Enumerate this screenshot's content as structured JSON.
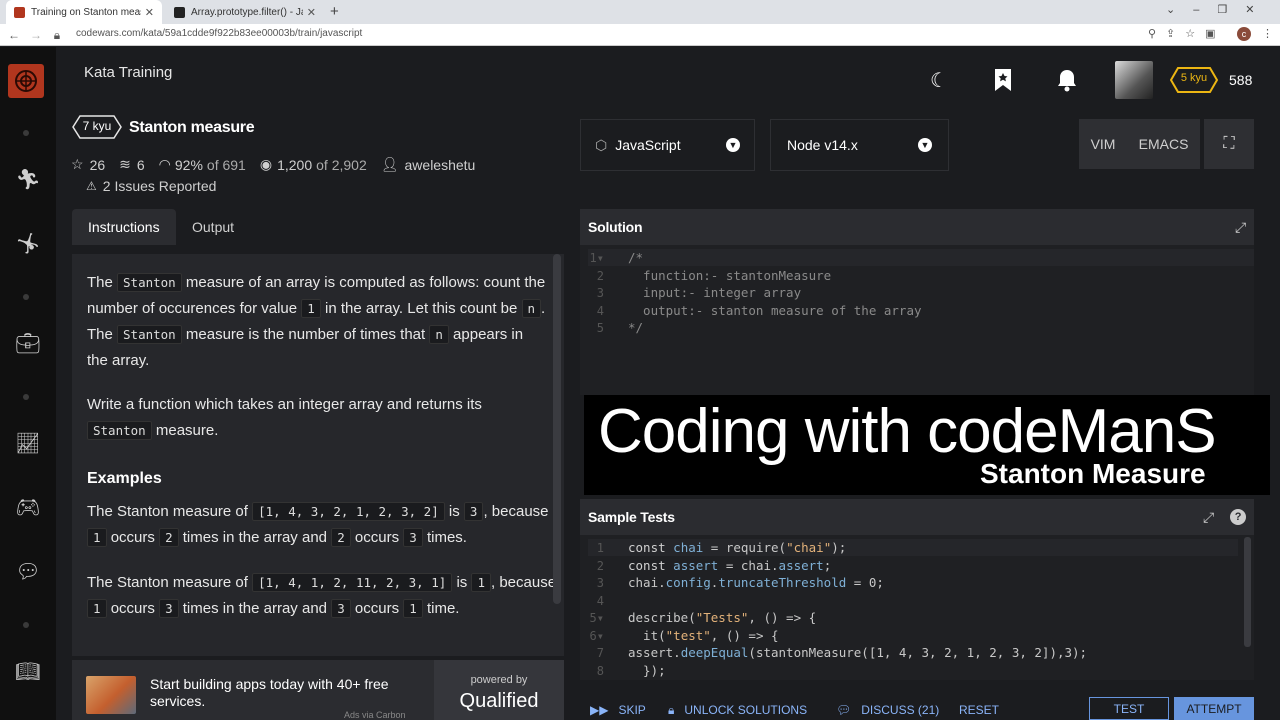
{
  "browser": {
    "tabs": [
      {
        "title": "Training on Stanton measure | C..."
      },
      {
        "title": "Array.prototype.filter() - JavaScri..."
      }
    ],
    "url": "codewars.com/kata/59a1cdde9f922b83ee00003b/train/javascript"
  },
  "header": {
    "section_title": "Kata Training",
    "rank_badge": "5 kyu",
    "honor": "588"
  },
  "kata": {
    "rank": "7 kyu",
    "title": "Stanton measure",
    "stars": "26",
    "collections": "6",
    "satisfaction": "92%",
    "satisfaction_of": "of 691",
    "completed": "1,200",
    "completed_of": "of 2,902",
    "author": "aweleshetu",
    "issues": "2 Issues Reported"
  },
  "tabs": {
    "instructions": "Instructions",
    "output": "Output"
  },
  "instructions": {
    "p1_a": "The",
    "p1_code1": "Stanton",
    "p1_b": "measure of an array is computed as follows: count the number of occurences for value",
    "p1_code2": "1",
    "p1_c": "in the array. Let this count be",
    "p1_code3": "n",
    "p1_d": ". The",
    "p1_code4": "Stanton",
    "p1_e": "measure is the number of times that",
    "p1_code5": "n",
    "p1_f": "appears in the array.",
    "p2_a": "Write a function which takes an integer array and returns its",
    "p2_code": "Stanton",
    "p2_b": "measure.",
    "examples_heading": "Examples",
    "ex1_a": "The Stanton measure of",
    "ex1_arr": "[1, 4, 3, 2, 1, 2, 3, 2]",
    "ex1_b": "is",
    "ex1_res": "3",
    "ex1_c": ",",
    "ex1_d": "because",
    "ex1_c1": "1",
    "ex1_e": "occurs",
    "ex1_c2": "2",
    "ex1_f": "times in the array and",
    "ex1_c3": "2",
    "ex1_g": "occurs",
    "ex1_c4": "3",
    "ex1_h": "times.",
    "ex2_a": "The Stanton measure of",
    "ex2_arr": "[1, 4, 1, 2, 11, 2, 3, 1]",
    "ex2_b": "is",
    "ex2_res": "1",
    "ex2_c": ",",
    "ex2_d": "because",
    "ex2_c1": "1",
    "ex2_e": "occurs",
    "ex2_c2": "3",
    "ex2_f": "times in the array and",
    "ex2_c3": "3",
    "ex2_g": "occurs",
    "ex2_c4": "1",
    "ex2_h": "time."
  },
  "ad": {
    "text": "Start building apps today with 40+ free services.",
    "powered_by": "powered by",
    "brand": "Qualified",
    "via": "Ads via Carbon"
  },
  "editor_settings": {
    "language": "JavaScript",
    "runtime": "Node v14.x",
    "vim": "VIM",
    "emacs": "EMACS"
  },
  "solution": {
    "header": "Solution",
    "lines": [
      "/*",
      "  function:- stantonMeasure",
      "  input:- integer array",
      "  output:- stanton measure of the array",
      "*/"
    ]
  },
  "overlay": {
    "title": "Coding with codeManS",
    "subtitle": "Stanton Measure"
  },
  "sample_tests": {
    "header": "Sample Tests"
  },
  "bottom": {
    "skip": "SKIP",
    "unlock": "UNLOCK SOLUTIONS",
    "discuss": "DISCUSS (21)",
    "reset": "RESET",
    "test": "TEST",
    "attempt": "ATTEMPT"
  },
  "colors": {
    "brand_red": "#b1361e",
    "rank_yellow": "#ecb613",
    "attempt_blue": "#6795de"
  }
}
